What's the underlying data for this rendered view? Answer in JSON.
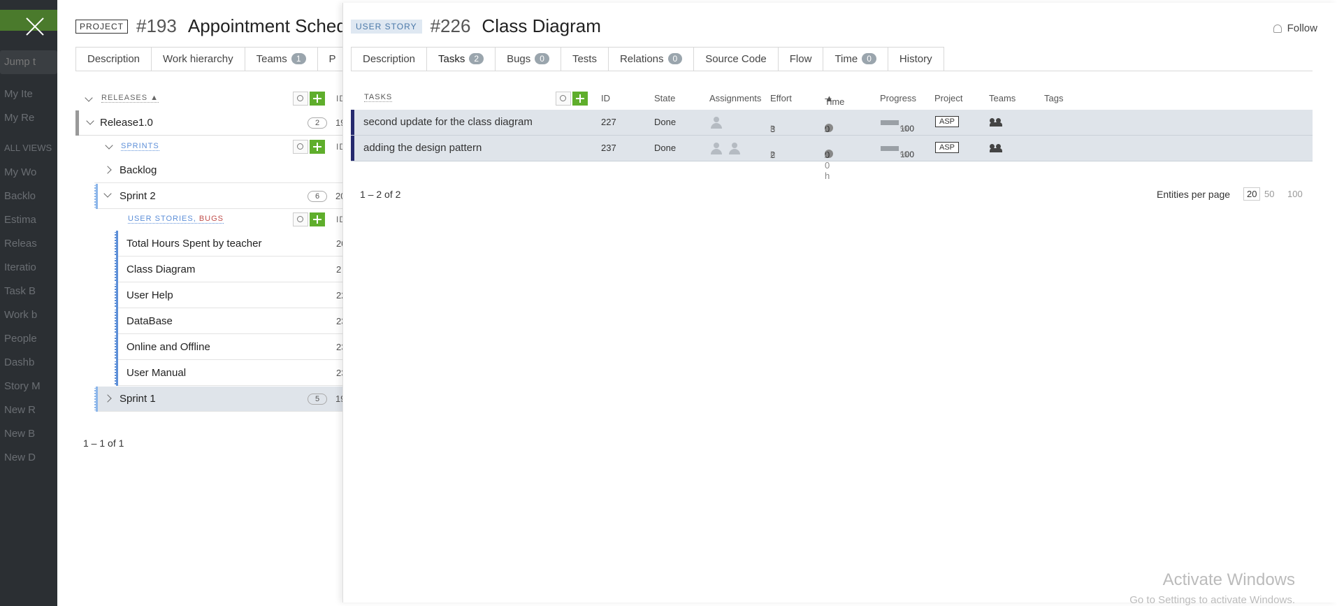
{
  "background": {
    "jump_placeholder": "Jump t",
    "items": [
      "My Ite",
      "My Re",
      "ALL VIEWS",
      "My Wo",
      "Backlo",
      "Estima",
      "Releas",
      "Iteratio",
      "Task B",
      "Work b",
      "People",
      "Dashb",
      "Story M",
      "New R",
      "New B",
      "New D"
    ]
  },
  "project": {
    "tag": "PROJECT",
    "number": "#193",
    "title": "Appointment Sched",
    "tabs": [
      {
        "label": "Description"
      },
      {
        "label": "Work hierarchy"
      },
      {
        "label": "Teams",
        "badge": "1"
      },
      {
        "label": "P"
      }
    ],
    "releases_header": "RELEASES",
    "id_col": "ID",
    "release": {
      "name": "Release1.0",
      "count": "2",
      "id": "19"
    },
    "sprints_header": "SPRINTS",
    "backlog": "Backlog",
    "sprint2": {
      "name": "Sprint 2",
      "count": "6",
      "id": "20"
    },
    "items_header_a": "USER STORIES",
    "items_header_b": "BUGS",
    "items": [
      {
        "name": "Total Hours Spent by teacher",
        "id": "20"
      },
      {
        "name": "Class Diagram",
        "id": "2"
      },
      {
        "name": "User Help",
        "id": "22"
      },
      {
        "name": "DataBase",
        "id": "23"
      },
      {
        "name": "Online and Offline",
        "id": "23"
      },
      {
        "name": "User Manual",
        "id": "23"
      }
    ],
    "sprint1": {
      "name": "Sprint 1",
      "count": "5",
      "id": "19"
    },
    "pager": "1 – 1 of 1"
  },
  "story": {
    "tag": "USER STORY",
    "number": "#226",
    "title": "Class Diagram",
    "follow": "Follow",
    "tabs": [
      {
        "label": "Description"
      },
      {
        "label": "Tasks",
        "badge": "2"
      },
      {
        "label": "Bugs",
        "badge": "0"
      },
      {
        "label": "Tests"
      },
      {
        "label": "Relations",
        "badge": "0"
      },
      {
        "label": "Source Code"
      },
      {
        "label": "Flow"
      },
      {
        "label": "Time",
        "badge": "0"
      },
      {
        "label": "History"
      }
    ],
    "table": {
      "header": "TASKS",
      "columns": [
        "ID",
        "State",
        "Assignments",
        "Effort",
        "Time",
        "Progress",
        "Project",
        "Teams",
        "Tags"
      ],
      "rows": [
        {
          "name": "second update for the class diagram",
          "id": "227",
          "state": "Done",
          "effort": "3",
          "effort_unit": "h",
          "time_spent": "0",
          "time_total": "/ 0 h",
          "progress": "100",
          "progress_unit": "%",
          "project": "ASP"
        },
        {
          "name": "adding the design pattern",
          "id": "237",
          "state": "Done",
          "effort": "2",
          "effort_unit": "h",
          "time_spent": "0",
          "time_total": "/ 0 h",
          "progress": "100",
          "progress_unit": "%",
          "project": "ASP"
        }
      ]
    },
    "pager": "1 – 2 of 2",
    "per_page_label": "Entities per page",
    "per_page_options": [
      "20",
      "50",
      "100"
    ]
  },
  "watermark": {
    "line1": "Activate Windows",
    "line2": "Go to Settings to activate Windows."
  }
}
